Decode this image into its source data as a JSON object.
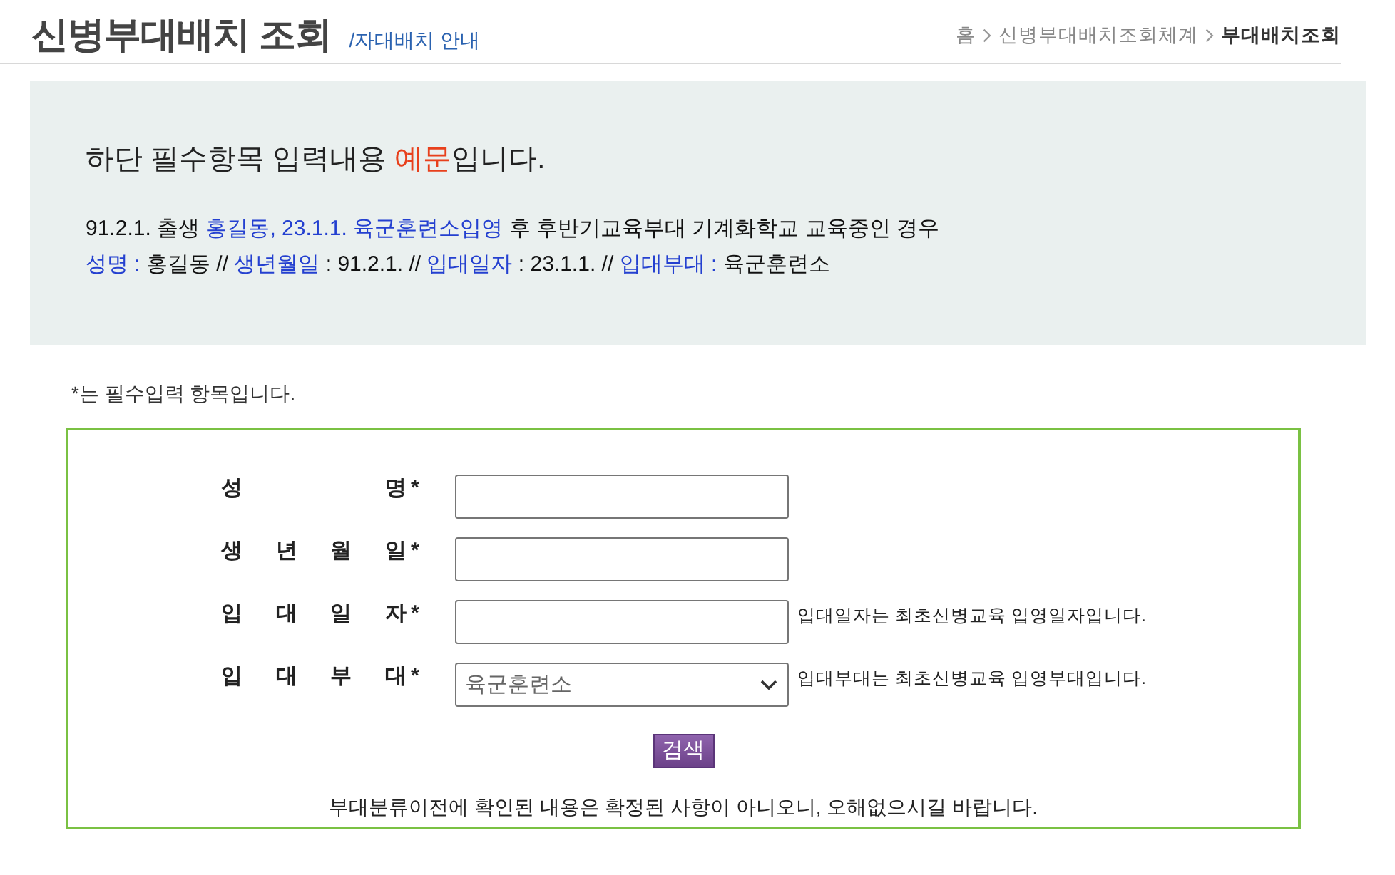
{
  "header": {
    "title": "신병부대배치 조회",
    "subtitle": "/자대배치 안내",
    "breadcrumb": [
      {
        "label": "홈",
        "current": false
      },
      {
        "label": "신병부대배치조회체계",
        "current": false
      },
      {
        "label": "부대배치조회",
        "current": true
      }
    ]
  },
  "example": {
    "heading": [
      {
        "text": "하단 필수항목 입력내용 ",
        "highlight": false
      },
      {
        "text": "예문",
        "highlight": true
      },
      {
        "text": "입니다.",
        "highlight": false
      }
    ],
    "lines": [
      [
        {
          "text": "91.2.1. 출생 ",
          "highlight": false
        },
        {
          "text": "홍길동, 23.1.1. 육군훈련소입영",
          "highlight": true
        },
        {
          "text": " 후 후반기교육부대 기계화학교 교육중인 경우",
          "highlight": false
        }
      ],
      [
        {
          "text": "성명 :",
          "highlight": true
        },
        {
          "text": " 홍길동 // ",
          "highlight": false
        },
        {
          "text": "생년월일",
          "highlight": true
        },
        {
          "text": " : 91.2.1. // ",
          "highlight": false
        },
        {
          "text": "입대일자",
          "highlight": true
        },
        {
          "text": " : 23.1.1. // ",
          "highlight": false
        },
        {
          "text": "입대부대 :",
          "highlight": true
        },
        {
          "text": " 육군훈련소",
          "highlight": false
        }
      ]
    ]
  },
  "required_note": "*는 필수입력 항목입니다.",
  "form": {
    "fields": [
      {
        "kind": "text",
        "label": "성 명",
        "mark": "*"
      },
      {
        "kind": "text",
        "label": "생 년 월 일",
        "mark": "*"
      },
      {
        "kind": "text",
        "label": "입 대 일 자",
        "mark": "*",
        "hint": "입대일자는 최초신병교육 입영일자입니다."
      },
      {
        "kind": "select",
        "label": "입 대 부 대",
        "mark": "*",
        "value": "육군훈련소",
        "hint": "입대부대는 최초신병교육 입영부대입니다."
      }
    ],
    "button": "검색",
    "notice": "부대분류이전에 확인된 내용은 확정된 사항이 아니오니, 오해없으시길 바랍니다."
  }
}
